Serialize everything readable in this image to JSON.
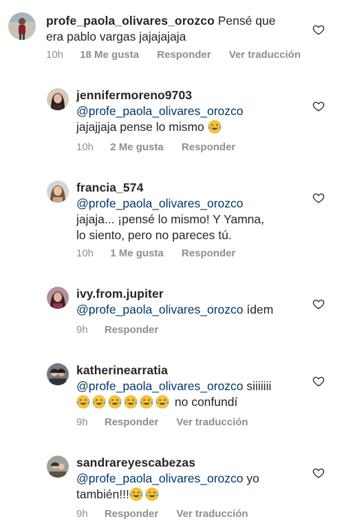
{
  "colors": {
    "text": "#262626",
    "secondary": "#8e8e8e",
    "mention": "#00376b"
  },
  "comments": [
    {
      "username": "profe_paola_olivares_orozco",
      "line1": "Pensé que",
      "line2": "era pablo vargas jajajajaja",
      "time": "10h",
      "likes": "18 Me gusta",
      "reply": "Responder",
      "translate": "Ver traducción"
    },
    {
      "username": "jennifermoreno9703",
      "mention": "@profe_paola_olivares_orozco",
      "line": "jajajjaja pense lo mismo",
      "emoji": "face-with-tears-of-joy-icon",
      "time": "10h",
      "likes": "2 Me gusta",
      "reply": "Responder"
    },
    {
      "username": "francia_574",
      "mention": "@profe_paola_olivares_orozco",
      "line1": "jajaja... ¡pensé lo mismo! Y Yamna,",
      "line2": "lo siento, pero no pareces tú.",
      "time": "10h",
      "likes": "1 Me gusta",
      "reply": "Responder"
    },
    {
      "username": "ivy.from.jupiter",
      "mention": "@profe_paola_olivares_orozco",
      "after": "ídem",
      "time": "9h",
      "reply": "Responder"
    },
    {
      "username": "katherinearratia",
      "mention": "@profe_paola_olivares_orozco",
      "after": "siiiiiii",
      "line2": "no confundí",
      "emoji": "face-with-tears-of-joy-icon",
      "time": "9h",
      "reply": "Responder",
      "translate": "Ver traducción"
    },
    {
      "username": "sandrareyescabezas",
      "mention": "@profe_paola_olivares_orozco",
      "after": "yo",
      "line2": "también!!!",
      "emoji": "face-with-tears-of-joy-icon",
      "time": "9h",
      "reply": "Responder",
      "translate": "Ver traducción"
    }
  ]
}
